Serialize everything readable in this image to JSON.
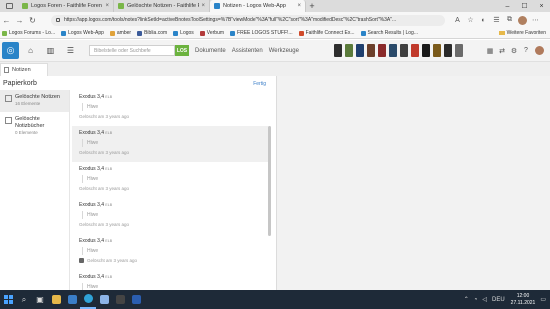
{
  "browser": {
    "tabs": [
      {
        "title": "Logos Foren - Faithlife Foren",
        "favicon_color": "#7ab648"
      },
      {
        "title": "Gelöschte Notizen - Faithlife Fo...",
        "favicon_color": "#7ab648"
      },
      {
        "title": "Notizen - Logos Web-App",
        "favicon_color": "#2a84c8"
      }
    ],
    "url": "https://app.logos.com/tools/notes?linkSetId=activeBnotesToolSettings=%7B\"viewMode\"%3A\"full\"%2C\"sort\"%3A\"modifiedDesc\"%2C\"trashSort\"%3A\"...",
    "bookmarks": [
      {
        "label": "Logos Forums - Lo...",
        "color": "#7ab648"
      },
      {
        "label": "Logos Web-App",
        "color": "#2a84c8"
      },
      {
        "label": "amber",
        "color": "#e0a23a"
      },
      {
        "label": "Biblia.com",
        "color": "#3b5b9a"
      },
      {
        "label": "Logos",
        "color": "#2a84c8"
      },
      {
        "label": "Verbum",
        "color": "#b23a3a"
      },
      {
        "label": "FREE LOGOS STUFF!...",
        "color": "#2a84c8"
      },
      {
        "label": "Faithlife Connect Ex...",
        "color": "#d04a2a"
      },
      {
        "label": "Search Results | Log...",
        "color": "#2a84c8"
      }
    ],
    "other_favorites": "Weitere Favoriten"
  },
  "logos_toolbar": {
    "search_placeholder": "Bibelstelle oder Suchbefe",
    "go_label": "LOS",
    "nav": [
      "Dokumente",
      "Assistenten",
      "Werkzeuge"
    ],
    "book_colors": [
      "#2d2d2d",
      "#5a7a3a",
      "#1f3f6e",
      "#6b3f2a",
      "#8a2a2a",
      "#2a4a6a",
      "#3f3f3f",
      "#c0392b",
      "#1a1a1a",
      "#7a5a1a",
      "#2a2a2a",
      "#6a6a6a"
    ]
  },
  "panel_tab": {
    "label": "Notizen"
  },
  "panel": {
    "title": "Papierkorb",
    "done": "Fertig",
    "sidebar": [
      {
        "label": "Gelöschte Notizen",
        "sub": "16 Elemente",
        "selected": true
      },
      {
        "label": "Gelöschte Notizbücher",
        "sub": "0 Elemente",
        "selected": false
      }
    ],
    "notes": [
      {
        "ref": "Exodus 3,4",
        "ver": "ELB",
        "body": "Hiwe",
        "meta": "Gelöscht am 3 years ago",
        "icon": false
      },
      {
        "ref": "Exodus 3,4",
        "ver": "ELB",
        "body": "Hiwe",
        "meta": "Gelöscht am 3 years ago",
        "icon": false
      },
      {
        "ref": "Exodus 3,4",
        "ver": "ELB",
        "body": "Hiwe",
        "meta": "Gelöscht am 3 years ago",
        "icon": false
      },
      {
        "ref": "Exodus 3,4",
        "ver": "ELB",
        "body": "Hiwe",
        "meta": "Gelöscht am 3 years ago",
        "icon": false
      },
      {
        "ref": "Exodus 3,4",
        "ver": "ELB",
        "body": "Hiwe",
        "meta": "Gelöscht am 3 years ago",
        "icon": true
      },
      {
        "ref": "Exodus 3,4",
        "ver": "ELB",
        "body": "Hiwe",
        "meta": "",
        "icon": false
      }
    ]
  },
  "taskbar": {
    "apps": [
      "search",
      "task-view",
      "file-explorer",
      "store",
      "edge",
      "mail",
      "logos",
      "word"
    ],
    "language": "DEU",
    "time": "12:00",
    "date": "27.11.2021"
  }
}
